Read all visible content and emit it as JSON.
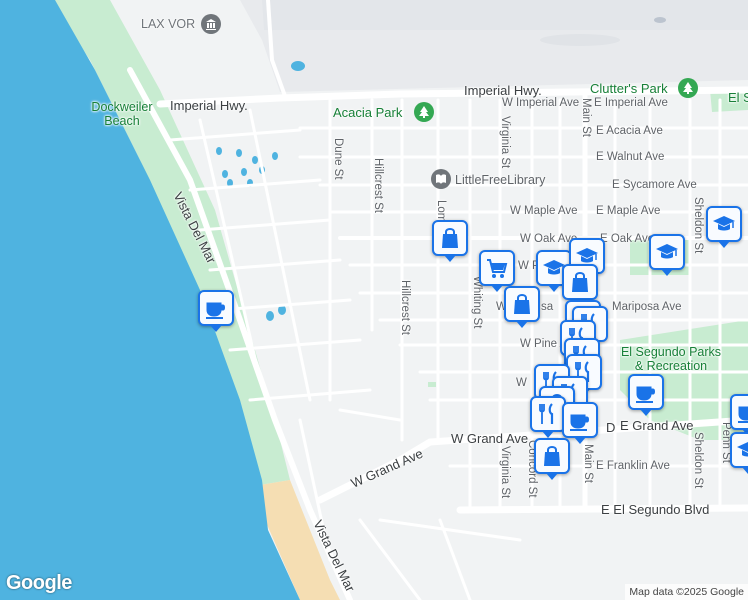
{
  "map": {
    "colors": {
      "water": "#4fb3e0",
      "sand": "#f5deb3",
      "park": "#c8ecd1",
      "land": "#f1f3f4",
      "airport": "#e8eaed",
      "road": "#ffffff",
      "pin_border": "#1a73e8"
    },
    "attribution": "Map data ©2025 Google",
    "logo": "Google"
  },
  "places": {
    "lax_vor": "LAX VOR",
    "dockweiler_beach": "Dockweiler Beach",
    "acacia_park": "Acacia Park",
    "clutters_park": "Clutter's Park",
    "little_free_library": "LittleFreeLibrary",
    "el_segundo_parks": "El Segundo Parks & Recreation",
    "el_partial": "El S"
  },
  "streets": {
    "imperial_hwy_left": "Imperial Hwy.",
    "imperial_hwy_right": "Imperial Hwy.",
    "w_imperial_ave": "W Imperial Ave",
    "e_imperial_ave": "E Imperial Ave",
    "e_acacia_ave": "E Acacia Ave",
    "e_walnut_ave": "E Walnut Ave",
    "e_sycamore_ave": "E Sycamore Ave",
    "w_maple_ave": "W Maple Ave",
    "e_maple_ave": "E Maple Ave",
    "w_oak_ave": "W Oak Ave",
    "e_oak_ave": "E Oak Ave",
    "w_p_partial": "W P",
    "w_mariposa_partial_w": "W",
    "w_mariposa_partial_sa": "sa",
    "mariposa_ave": "Mariposa Ave",
    "w_pine_partial": "W Pine A",
    "w_partial": "W",
    "w_grand_ave": "W Grand Ave",
    "w_grand_ave_2": "W Grand Ave",
    "e_grand_ave": "E Grand Ave",
    "e_grand_prefix": "D",
    "e_franklin_ave": "E Franklin Ave",
    "e_el_segundo_blvd": "E El Segundo Blvd",
    "vista_del_mar_1": "Vista Del Mar",
    "vista_del_mar_2": "Vista Del Mar",
    "dune_st": "Dune St",
    "hillcrest_st_1": "Hillcrest St",
    "hillcrest_st_2": "Hillcrest St",
    "lomita_st": "Lomita St",
    "virginia_st_1": "Virginia St",
    "virginia_st_2": "Virginia St",
    "whiting_st": "Whiting St",
    "concord_st": "Concord St",
    "main_st_1": "Main St",
    "main_st_2": "Main St",
    "sheldon_st_1": "Sheldon St",
    "sheldon_st_2": "Sheldon St",
    "penn_st": "Penn St"
  },
  "markers": [
    {
      "icon": "cafe",
      "label": "cafe-marker"
    },
    {
      "icon": "shopping-bag",
      "label": "shopping-marker"
    },
    {
      "icon": "shopping-cart",
      "label": "grocery-marker"
    },
    {
      "icon": "school",
      "label": "school-marker"
    },
    {
      "icon": "restaurant",
      "label": "restaurant-marker"
    }
  ]
}
